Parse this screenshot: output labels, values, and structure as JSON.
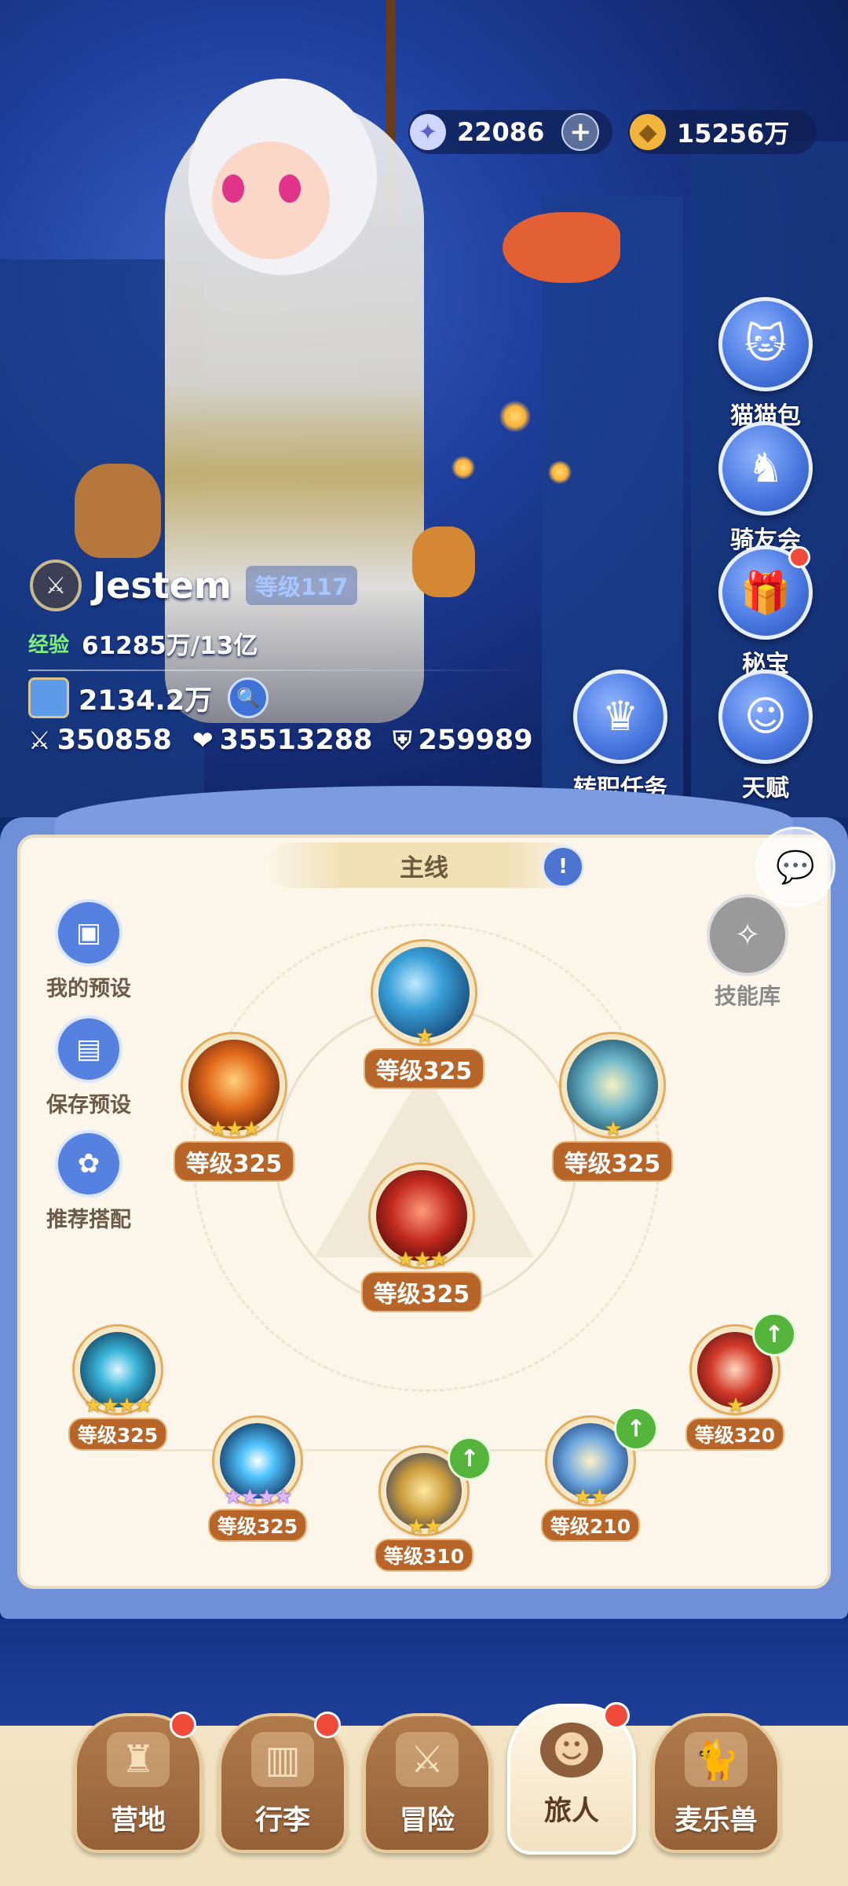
{
  "currency": {
    "gems": "22086",
    "gold": "15256万"
  },
  "side_buttons": [
    {
      "label": "猫猫包",
      "icon": "cat-bag-icon",
      "badge": false
    },
    {
      "label": "骑友会",
      "icon": "horse-icon",
      "badge": false
    },
    {
      "label": "秘宝",
      "icon": "treasure-icon",
      "badge": true
    },
    {
      "label": "天赋",
      "icon": "brain-icon",
      "badge": false
    }
  ],
  "job_task": {
    "label": "转职任务",
    "icon": "crown-icon"
  },
  "player": {
    "name": "Jestem",
    "level": "等级117",
    "exp_label": "经验",
    "exp_value": "61285万/13亿",
    "power": "2134.2万",
    "attack": "350858",
    "hp": "35513288",
    "defense": "259989"
  },
  "panel": {
    "tab": "主线",
    "presets": [
      {
        "label": "我的预设",
        "icon": "cards-icon"
      },
      {
        "label": "保存预设",
        "icon": "save-icon"
      },
      {
        "label": "推荐搭配",
        "icon": "recommend-icon"
      }
    ],
    "skill_bank": "技能库"
  },
  "skills": [
    {
      "id": "top",
      "level": "等级325",
      "stars": "★",
      "star_color": "gold",
      "upgrade": false,
      "gradient": "radial-gradient(circle at 40% 40%,#bfe9ff 0%,#3aa0d8 35%,#164a7a 80%)"
    },
    {
      "id": "upper-left",
      "level": "等级325",
      "stars": "★★★",
      "star_color": "gold",
      "upgrade": false,
      "gradient": "radial-gradient(circle at 50% 45%,#ffd27a 0%,#e36a1c 40%,#5a1e0a 85%)"
    },
    {
      "id": "upper-right",
      "level": "等级325",
      "stars": "★",
      "star_color": "gold",
      "upgrade": false,
      "gradient": "radial-gradient(circle at 50% 50%,#f8f1c0 0%,#6fb7c9 40%,#1b4f6b 85%)"
    },
    {
      "id": "center",
      "level": "等级325",
      "stars": "★★★",
      "star_color": "gold",
      "upgrade": false,
      "gradient": "radial-gradient(circle at 50% 45%,#ff9a7a 0%,#c22a1e 45%,#4a0c08 85%)"
    },
    {
      "id": "row-1",
      "level": "等级325",
      "stars": "★★★★",
      "star_color": "gold",
      "upgrade": false,
      "gradient": "radial-gradient(circle at 50% 50%,#e0f6ff 0%,#3bb6d9 35%,#0f3d5c 85%)"
    },
    {
      "id": "row-2",
      "level": "等级325",
      "stars": "★★★★",
      "star_color": "purple",
      "upgrade": false,
      "gradient": "radial-gradient(circle at 50% 50%,#ffffff 0%,#52c6ff 30%,#0c2e5a 85%)"
    },
    {
      "id": "row-3",
      "level": "等级310",
      "stars": "★★",
      "star_color": "gold",
      "upgrade": true,
      "gradient": "radial-gradient(circle at 50% 50%,#ffe9a0 0%,#c99a3b 45%,#2a3f6a 90%)"
    },
    {
      "id": "row-4",
      "level": "等级210",
      "stars": "★★",
      "star_color": "gold",
      "upgrade": true,
      "gradient": "radial-gradient(circle at 50% 50%,#fff3c8 0%,#6fa8df 45%,#1a3d77 90%)"
    },
    {
      "id": "row-5",
      "level": "等级320",
      "stars": "★",
      "star_color": "gold",
      "upgrade": true,
      "gradient": "radial-gradient(circle at 50% 50%,#ffd6c0 0%,#d33a2a 45%,#5a1010 90%)"
    }
  ],
  "bottom_nav": [
    {
      "label": "营地",
      "icon": "castle-icon",
      "badge": true,
      "active": false
    },
    {
      "label": "行李",
      "icon": "backpack-icon",
      "badge": true,
      "active": false
    },
    {
      "label": "冒险",
      "icon": "swords-icon",
      "badge": false,
      "active": false
    },
    {
      "label": "旅人",
      "icon": "traveler-icon",
      "badge": true,
      "active": true
    },
    {
      "label": "麦乐兽",
      "icon": "pet-icon",
      "badge": false,
      "active": false
    }
  ]
}
